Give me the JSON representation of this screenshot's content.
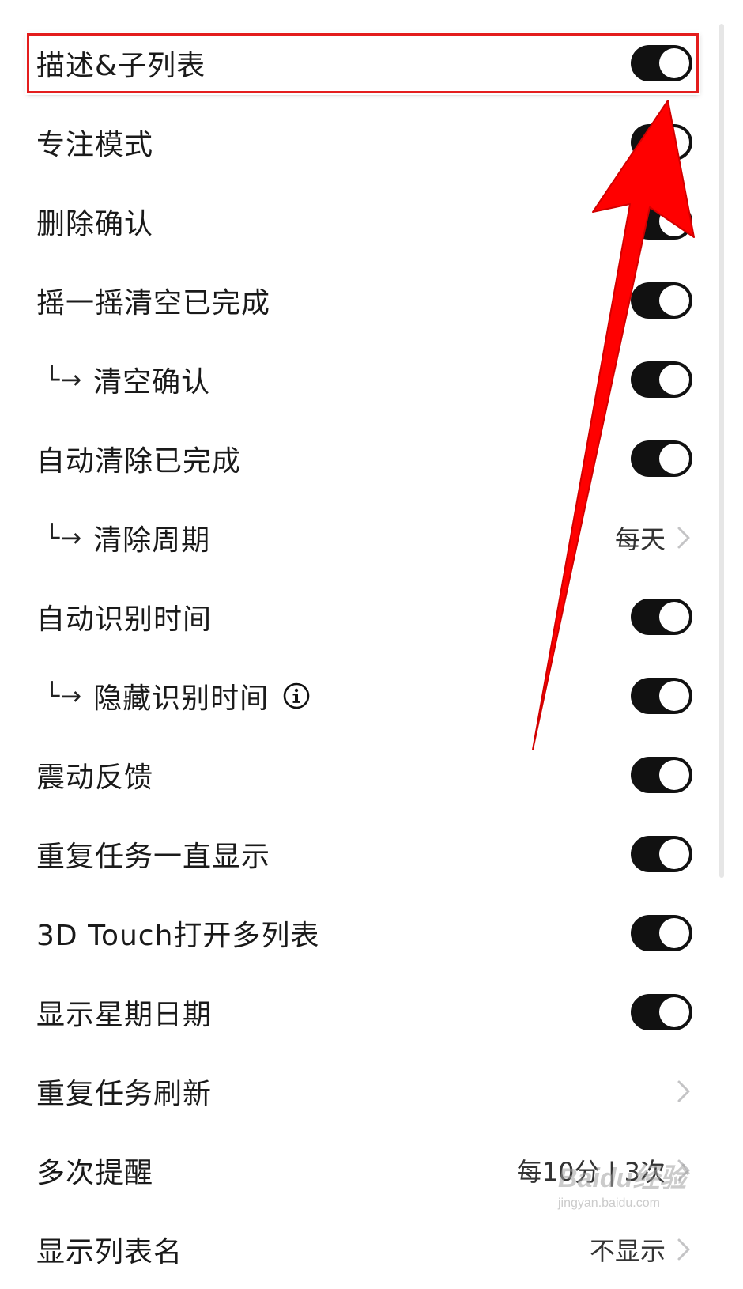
{
  "settings": {
    "rows": [
      {
        "label": "描述&子列表",
        "sub": false,
        "control": "toggle",
        "on": true
      },
      {
        "label": "专注模式",
        "sub": false,
        "control": "toggle",
        "on": true
      },
      {
        "label": "删除确认",
        "sub": false,
        "control": "toggle",
        "on": true
      },
      {
        "label": "摇一摇清空已完成",
        "sub": false,
        "control": "toggle",
        "on": true
      },
      {
        "label": "清空确认",
        "sub": true,
        "control": "toggle",
        "on": true
      },
      {
        "label": "自动清除已完成",
        "sub": false,
        "control": "toggle",
        "on": true
      },
      {
        "label": "清除周期",
        "sub": true,
        "control": "value",
        "value": "每天"
      },
      {
        "label": "自动识别时间",
        "sub": false,
        "control": "toggle",
        "on": true
      },
      {
        "label": "隐藏识别时间",
        "sub": true,
        "control": "toggle",
        "on": true,
        "info": true
      },
      {
        "label": "震动反馈",
        "sub": false,
        "control": "toggle",
        "on": true
      },
      {
        "label": "重复任务一直显示",
        "sub": false,
        "control": "toggle",
        "on": true
      },
      {
        "label": "3D Touch打开多列表",
        "sub": false,
        "control": "toggle",
        "on": true
      },
      {
        "label": "显示星期日期",
        "sub": false,
        "control": "toggle",
        "on": true
      },
      {
        "label": "重复任务刷新",
        "sub": false,
        "control": "chevron"
      },
      {
        "label": "多次提醒",
        "sub": false,
        "control": "value",
        "value": "每10分 | 3次"
      },
      {
        "label": "显示列表名",
        "sub": false,
        "control": "value",
        "value": "不显示"
      }
    ],
    "sub_prefix": "└→"
  },
  "annotation": {
    "highlight_color": "#e31c1c",
    "arrow_color": "#ff0000"
  },
  "watermark": {
    "brand": "Baidu经验",
    "url": "jingyan.baidu.com"
  }
}
